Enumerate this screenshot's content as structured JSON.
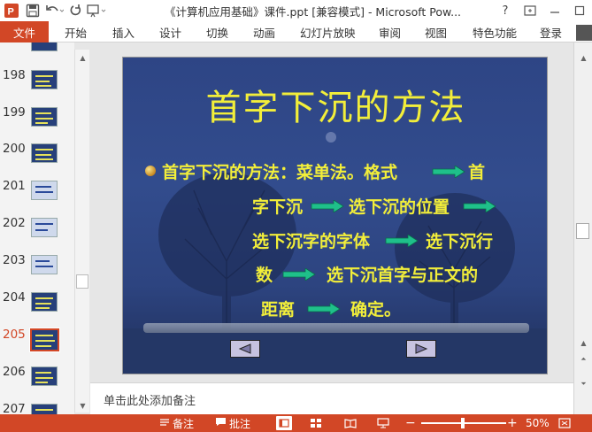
{
  "window": {
    "title": "《计算机应用基础》课件.ppt [兼容模式] - Microsoft Pow...",
    "help_label": "?",
    "icons": [
      "powerpoint-logo-icon",
      "save-icon",
      "undo-icon",
      "redo-icon",
      "presenter-icon",
      "restore-icon",
      "minimize-icon",
      "maximize-icon"
    ]
  },
  "ribbon": {
    "file_label": "文件",
    "tabs": [
      "开始",
      "插入",
      "设计",
      "切换",
      "动画",
      "幻灯片放映",
      "审阅",
      "视图",
      "特色功能"
    ],
    "login_label": "登录"
  },
  "thumbnails": [
    {
      "number": "198",
      "active": false
    },
    {
      "number": "199",
      "active": false
    },
    {
      "number": "200",
      "active": false
    },
    {
      "number": "201",
      "active": false
    },
    {
      "number": "202",
      "active": false
    },
    {
      "number": "203",
      "active": false
    },
    {
      "number": "204",
      "active": false
    },
    {
      "number": "205",
      "active": true
    },
    {
      "number": "206",
      "active": false
    },
    {
      "number": "207",
      "active": false
    }
  ],
  "slide": {
    "title": "首字下沉的方法",
    "lines": [
      "首字下沉的方法：菜单法。格式",
      "首",
      "字下沉",
      "选下沉的位置",
      "选下沉字的字体",
      "选下沉行",
      "数",
      "选下沉首字与正文的",
      "距离",
      "确定。"
    ],
    "prev_label": "◀",
    "next_label": "▶",
    "text_color": "#f2ee3a",
    "arrow_color": "#1fc08a"
  },
  "notes": {
    "placeholder": "单击此处添加备注"
  },
  "status": {
    "notes_label": "备注",
    "comments_label": "批注",
    "zoom": "50%",
    "zoom_minus": "−",
    "zoom_plus": "+",
    "accent": "#d24726"
  }
}
